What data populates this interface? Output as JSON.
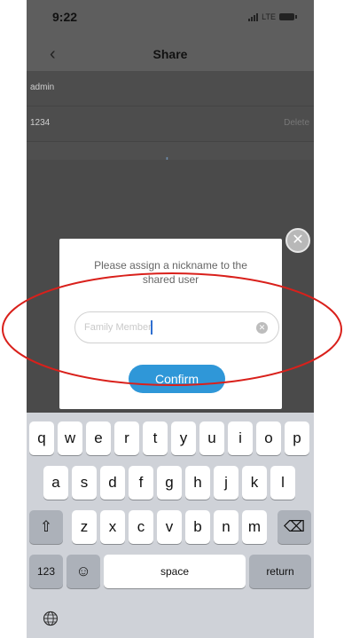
{
  "status": {
    "time": "9:22",
    "network": "LTE"
  },
  "nav": {
    "title": "Share",
    "back_icon": "chevron-left-icon"
  },
  "users": [
    {
      "label": "admin",
      "action": ""
    },
    {
      "label": "1234",
      "action": "Delete"
    }
  ],
  "add_icon": "plus-icon",
  "dialog": {
    "message": "Please assign a nickname to the shared user",
    "input_placeholder": "Family Member",
    "confirm_label": "Confirm",
    "close_icon": "close-icon",
    "clear_icon": "clear-icon"
  },
  "keyboard": {
    "row1": [
      "q",
      "w",
      "e",
      "r",
      "t",
      "y",
      "u",
      "i",
      "o",
      "p"
    ],
    "row2": [
      "a",
      "s",
      "d",
      "f",
      "g",
      "h",
      "j",
      "k",
      "l"
    ],
    "row3": [
      "z",
      "x",
      "c",
      "v",
      "b",
      "n",
      "m"
    ],
    "numbers_label": "123",
    "space_label": "space",
    "return_label": "return",
    "shift_icon": "shift-icon",
    "backspace_icon": "backspace-icon",
    "emoji_icon": "emoji-icon",
    "globe_icon": "globe-icon"
  },
  "colors": {
    "accent": "#2f97d8",
    "annotation": "#d9201b"
  }
}
